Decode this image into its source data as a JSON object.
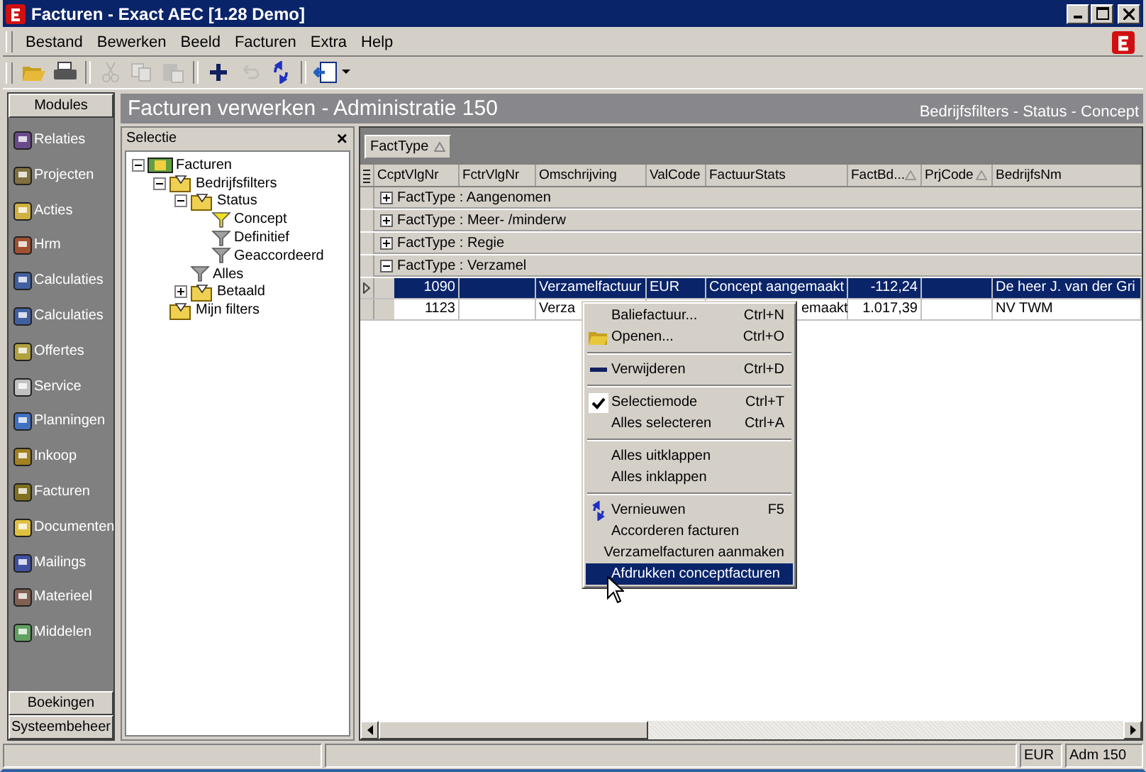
{
  "window": {
    "title": "Facturen - Exact AEC [1.28 Demo]"
  },
  "menu_bar": [
    "Bestand",
    "Bewerken",
    "Beeld",
    "Facturen",
    "Extra",
    "Help"
  ],
  "toolbar": [
    {
      "kind": "open",
      "disabled": false
    },
    {
      "kind": "print",
      "disabled": false
    },
    {
      "kind": "sep"
    },
    {
      "kind": "cut",
      "disabled": true
    },
    {
      "kind": "copy",
      "disabled": true
    },
    {
      "kind": "paste",
      "disabled": true
    },
    {
      "kind": "sep"
    },
    {
      "kind": "add",
      "disabled": false
    },
    {
      "kind": "undo",
      "disabled": true
    },
    {
      "kind": "refresh",
      "disabled": false
    },
    {
      "kind": "sep"
    },
    {
      "kind": "export",
      "disabled": false
    }
  ],
  "modules": {
    "header": "Modules",
    "items": [
      "Relaties",
      "Projecten",
      "Acties",
      "Hrm",
      "Calculaties",
      "Calculaties",
      "Offertes",
      "Service",
      "Planningen",
      "Inkoop",
      "Facturen",
      "Documenten",
      "Mailings",
      "Materieel",
      "Middelen"
    ],
    "footer_buttons": [
      "Boekingen",
      "Systeembeheer"
    ]
  },
  "page_header": {
    "title": "Facturen verwerken - Administratie 150",
    "subtitle": "Bedrijfsfilters - Status - Concept"
  },
  "selection_panel": {
    "title": "Selectie",
    "close": "×",
    "tree": [
      {
        "label": "Facturen",
        "kind": "root",
        "expanded": true,
        "children": [
          {
            "label": "Bedrijfsfilters",
            "kind": "folder",
            "expanded": true,
            "children": [
              {
                "label": "Status",
                "kind": "folder",
                "expanded": true,
                "children": [
                  {
                    "label": "Concept",
                    "kind": "filter",
                    "selected": true
                  },
                  {
                    "label": "Definitief",
                    "kind": "filter",
                    "selected": false
                  },
                  {
                    "label": "Geaccordeerd",
                    "kind": "filter",
                    "selected": false
                  }
                ]
              },
              {
                "label": "Alles",
                "kind": "filter",
                "selected": false
              },
              {
                "label": "Betaald",
                "kind": "folder",
                "expanded": false
              }
            ]
          },
          {
            "label": "Mijn filters",
            "kind": "folder"
          }
        ]
      }
    ]
  },
  "grid": {
    "group_by": {
      "label": "FactType",
      "sorted": true
    },
    "columns": [
      {
        "label": "CcptVlgNr",
        "sorted": false
      },
      {
        "label": "FctrVlgNr",
        "sorted": false
      },
      {
        "label": "Omschrijving",
        "sorted": false
      },
      {
        "label": "ValCode",
        "sorted": false
      },
      {
        "label": "FactuurStats",
        "sorted": false
      },
      {
        "label": "FactBd...",
        "sorted": true
      },
      {
        "label": "PrjCode",
        "sorted": true
      },
      {
        "label": "BedrijfsNm",
        "sorted": false
      }
    ],
    "groups": [
      {
        "label": "FactType : Aangenomen",
        "expanded": false
      },
      {
        "label": "FactType : Meer- /minderw",
        "expanded": false
      },
      {
        "label": "FactType : Regie",
        "expanded": false
      },
      {
        "label": "FactType : Verzamel",
        "expanded": true
      }
    ],
    "rows": [
      {
        "selected": true,
        "covered": false,
        "cells": [
          "1090",
          "",
          "Verzamelfactuur",
          "EUR",
          "Concept aangemaakt",
          "-112,24",
          "",
          "De heer J. van der Gri"
        ]
      },
      {
        "selected": false,
        "covered": true,
        "cells": [
          "1123",
          "",
          "Verza",
          "",
          "emaakt",
          "1.017,39",
          "",
          "NV TWM"
        ]
      }
    ]
  },
  "context_menu": {
    "groups": [
      [
        {
          "label": "Baliefactuur...",
          "shortcut": "Ctrl+N",
          "kind": "plain",
          "checked": false,
          "selected": false
        },
        {
          "label": "Openen...",
          "shortcut": "Ctrl+O",
          "kind": "open",
          "checked": false,
          "selected": false
        }
      ],
      [
        {
          "label": "Verwijderen",
          "shortcut": "Ctrl+D",
          "kind": "delete",
          "checked": false,
          "selected": false
        }
      ],
      [
        {
          "label": "Selectiemode",
          "shortcut": "Ctrl+T",
          "kind": "plain",
          "checked": true,
          "selected": false
        },
        {
          "label": "Alles selecteren",
          "shortcut": "Ctrl+A",
          "kind": "plain",
          "checked": false,
          "selected": false
        }
      ],
      [
        {
          "label": "Alles uitklappen",
          "kind": "plain",
          "checked": false,
          "selected": false
        },
        {
          "label": "Alles inklappen",
          "kind": "plain",
          "checked": false,
          "selected": false
        }
      ],
      [
        {
          "label": "Vernieuwen",
          "shortcut": "F5",
          "kind": "refresh",
          "checked": false,
          "selected": false
        },
        {
          "label": "Accorderen facturen",
          "kind": "plain",
          "checked": false,
          "selected": false
        },
        {
          "label": "Verzamelfacturen aanmaken",
          "kind": "plain",
          "checked": false,
          "selected": false
        },
        {
          "label": "Afdrukken conceptfacturen",
          "kind": "plain",
          "checked": false,
          "selected": true
        }
      ]
    ]
  },
  "status_bar": {
    "currency": "EUR",
    "administration": "Adm 150"
  }
}
